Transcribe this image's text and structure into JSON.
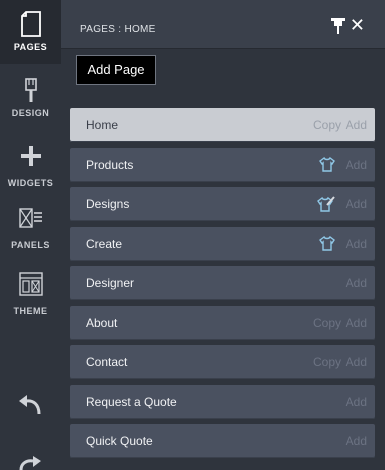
{
  "rail": {
    "items": [
      {
        "label": "PAGES",
        "icon": "page-icon"
      },
      {
        "label": "DESIGN",
        "icon": "brush-icon"
      },
      {
        "label": "WIDGETS",
        "icon": "plus-icon"
      },
      {
        "label": "PANELS",
        "icon": "panels-icon"
      },
      {
        "label": "THEME",
        "icon": "theme-icon"
      }
    ]
  },
  "header": {
    "title": "PAGES : HOME"
  },
  "add_page_label": "Add Page",
  "pages": [
    {
      "label": "Home",
      "copy": "Copy",
      "add": "Add"
    },
    {
      "label": "Products",
      "add": "Add"
    },
    {
      "label": "Designs",
      "add": "Add"
    },
    {
      "label": "Create",
      "add": "Add"
    },
    {
      "label": "Designer",
      "add": "Add"
    },
    {
      "label": "About",
      "copy": "Copy",
      "add": "Add"
    },
    {
      "label": "Contact",
      "copy": "Copy",
      "add": "Add"
    },
    {
      "label": "Request a Quote",
      "add": "Add"
    },
    {
      "label": "Quick Quote",
      "add": "Add"
    }
  ],
  "colors": {
    "rail": "#2f343d",
    "row": "#4a5160",
    "row_selected": "#c9ccd2",
    "accent": "#8fc7e6"
  }
}
